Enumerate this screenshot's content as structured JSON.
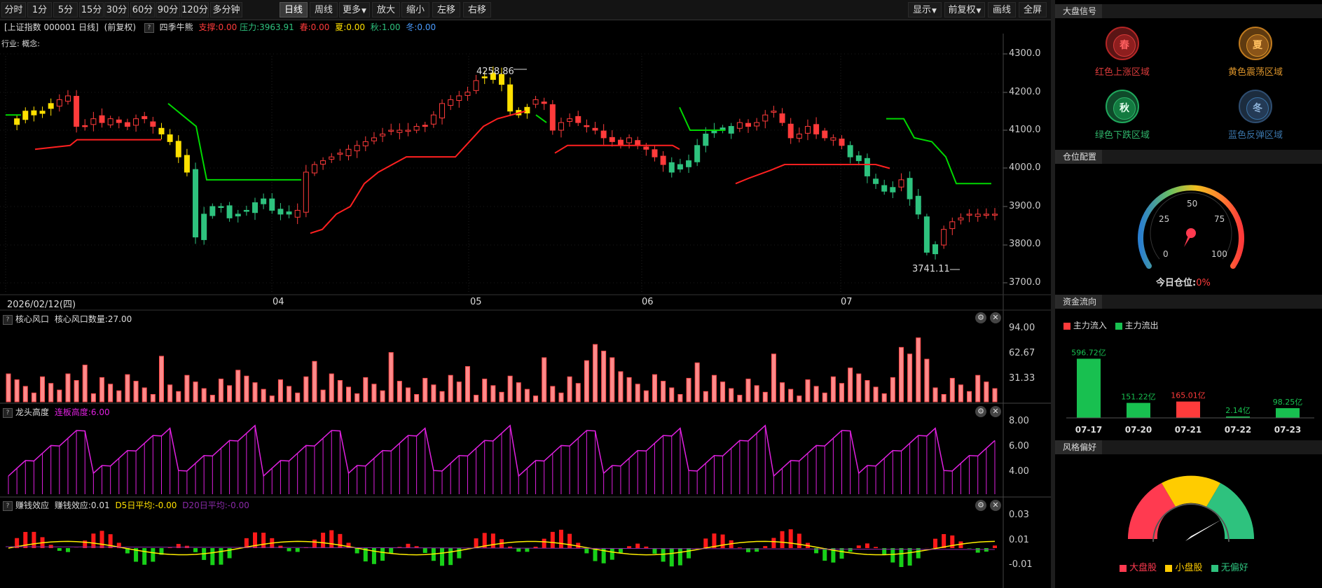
{
  "toolbar": {
    "periods": [
      "分时",
      "1分",
      "5分",
      "15分",
      "30分",
      "60分",
      "90分",
      "120分",
      "多分钟",
      "日线",
      "周线",
      "更多",
      "放大",
      "缩小",
      "左移",
      "右移"
    ],
    "active_period": "日线",
    "right_buttons": [
      "显示",
      "前复权",
      "画线",
      "全屏"
    ]
  },
  "info": {
    "title": "[上证指数 000001 日线]",
    "fq": "(前复权)",
    "qmark": "?",
    "indicator": "四季牛熊",
    "support": "支撑:0.00",
    "pressure": "压力:3963.91",
    "spring": "春:0.00",
    "summer": "夏:0.00",
    "autumn": "秋:1.00",
    "winter": "冬:0.00",
    "industry": "行业: 概念:"
  },
  "main_chart": {
    "date_label": "2026/02/12(四)",
    "month_labels": [
      "04",
      "05",
      "06",
      "07"
    ],
    "y_ticks": [
      "4300.0",
      "4200.0",
      "4100.0",
      "4000.0",
      "3900.0",
      "3800.0",
      "3700.0"
    ],
    "high_label": "4258.86",
    "low_label": "3741.11"
  },
  "panel1": {
    "label": "核心风口",
    "value_label": "核心风口数量:27.00",
    "y_ticks": [
      "94.00",
      "62.67",
      "31.33"
    ]
  },
  "panel2": {
    "label": "龙头高度",
    "value_label": "连板高度:6.00",
    "y_ticks": [
      "8.00",
      "6.00",
      "4.00"
    ]
  },
  "panel3": {
    "label": "赚钱效应",
    "value_label": "赚钱效应:0.01",
    "d5": "D5日平均:-0.00",
    "d20": "D20日平均:-0.00",
    "y_ticks": [
      "0.03",
      "0.01",
      "-0.01"
    ]
  },
  "sidebar": {
    "market_signal": {
      "title": "大盘信号",
      "items": [
        {
          "glyph": "春",
          "label": "红色上涨区域",
          "color": "#d83a3a"
        },
        {
          "glyph": "夏",
          "label": "黄色震荡区域",
          "color": "#d9922a"
        },
        {
          "glyph": "秋",
          "label": "绿色下跌区域",
          "color": "#2fb36a"
        },
        {
          "glyph": "冬",
          "label": "蓝色反弹区域",
          "color": "#3a74a8"
        }
      ]
    },
    "position": {
      "title": "仓位配置",
      "gauge_ticks": [
        "0",
        "25",
        "50",
        "75",
        "100"
      ],
      "today_label": "今日仓位:",
      "today_value": "0%",
      "value": 0
    },
    "fund_flow": {
      "title": "资金流向",
      "legend_in": "主力流入",
      "legend_out": "主力流出",
      "bars": [
        {
          "date": "07-17",
          "value": 596.72,
          "label": "596.72亿",
          "dir": "out"
        },
        {
          "date": "07-20",
          "value": 151.22,
          "label": "151.22亿",
          "dir": "out"
        },
        {
          "date": "07-21",
          "value": 165.01,
          "label": "165.01亿",
          "dir": "in"
        },
        {
          "date": "07-22",
          "value": 2.14,
          "label": "2.14亿",
          "dir": "out"
        },
        {
          "date": "07-23",
          "value": 98.25,
          "label": "98.25亿",
          "dir": "out"
        }
      ]
    },
    "style": {
      "title": "风格偏好",
      "legend": [
        "大盘股",
        "小盘股",
        "无偏好"
      ]
    }
  },
  "colors": {
    "up": "#ff3b3b",
    "down": "#2ec27e",
    "yellow": "#ffe000",
    "green_line": "#00d800",
    "magenta": "#e020e0"
  }
}
